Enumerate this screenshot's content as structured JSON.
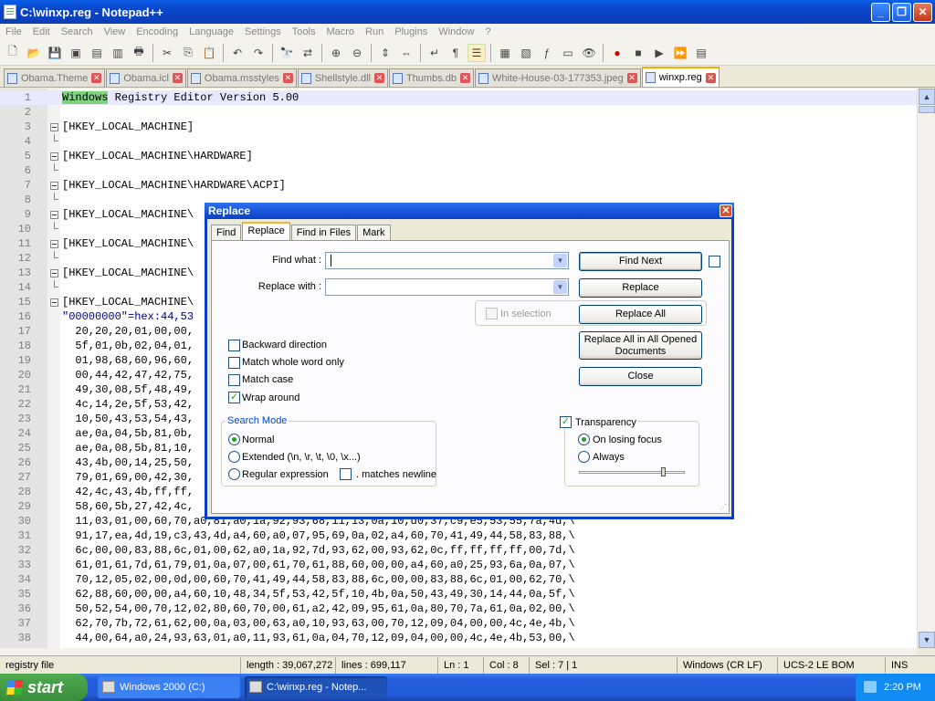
{
  "window": {
    "title": "C:\\winxp.reg - Notepad++"
  },
  "menu": [
    "File",
    "Edit",
    "Search",
    "View",
    "Encoding",
    "Language",
    "Settings",
    "Tools",
    "Macro",
    "Run",
    "Plugins",
    "Window",
    "?"
  ],
  "tabs": [
    {
      "label": "Obama.Theme",
      "active": false
    },
    {
      "label": "Obama.icl",
      "active": false
    },
    {
      "label": "Obama.msstyles",
      "active": false
    },
    {
      "label": "Shellstyle.dll",
      "active": false
    },
    {
      "label": "Thumbs.db",
      "active": false
    },
    {
      "label": "White-House-03-177353.jpeg",
      "active": false
    },
    {
      "label": "winxp.reg",
      "active": true
    }
  ],
  "editor": {
    "lines": [
      {
        "n": "1",
        "text": "Windows Registry Editor Version 5.00"
      },
      {
        "n": "2",
        "text": ""
      },
      {
        "n": "3",
        "text": "[HKEY_LOCAL_MACHINE]"
      },
      {
        "n": "4",
        "text": ""
      },
      {
        "n": "5",
        "text": "[HKEY_LOCAL_MACHINE\\HARDWARE]"
      },
      {
        "n": "6",
        "text": ""
      },
      {
        "n": "7",
        "text": "[HKEY_LOCAL_MACHINE\\HARDWARE\\ACPI]"
      },
      {
        "n": "8",
        "text": ""
      },
      {
        "n": "9",
        "text": "[HKEY_LOCAL_MACHINE\\"
      },
      {
        "n": "10",
        "text": ""
      },
      {
        "n": "11",
        "text": "[HKEY_LOCAL_MACHINE\\"
      },
      {
        "n": "12",
        "text": ""
      },
      {
        "n": "13",
        "text": "[HKEY_LOCAL_MACHINE\\"
      },
      {
        "n": "14",
        "text": ""
      },
      {
        "n": "15",
        "text": "[HKEY_LOCAL_MACHINE\\"
      },
      {
        "n": "16",
        "text": "\"00000000\"=hex:44,53"
      },
      {
        "n": "17",
        "text": "  20,20,20,01,00,00,"
      },
      {
        "n": "18",
        "text": "  5f,01,0b,02,04,01,"
      },
      {
        "n": "19",
        "text": "  01,98,68,60,96,60,"
      },
      {
        "n": "20",
        "text": "  00,44,42,47,42,75,"
      },
      {
        "n": "21",
        "text": "  49,30,08,5f,48,49,"
      },
      {
        "n": "22",
        "text": "  4c,14,2e,5f,53,42,"
      },
      {
        "n": "23",
        "text": "  10,50,43,53,54,43,"
      },
      {
        "n": "24",
        "text": "  ae,0a,04,5b,81,0b,"
      },
      {
        "n": "25",
        "text": "  ae,0a,08,5b,81,10,"
      },
      {
        "n": "26",
        "text": "  43,4b,00,14,25,50,"
      },
      {
        "n": "27",
        "text": "  79,01,69,00,42,30,"
      },
      {
        "n": "28",
        "text": "  42,4c,43,4b,ff,ff,"
      },
      {
        "n": "29",
        "text": "  58,60,5b,27,42,4c,"
      },
      {
        "n": "30",
        "text": "  11,03,01,00,60,70,a0,81,a0,1a,92,93,68,11,13,0a,10,d0,37,c9,e5,53,55,7a,4d,\\"
      },
      {
        "n": "31",
        "text": "  91,17,ea,4d,19,c3,43,4d,a4,60,a0,07,95,69,0a,02,a4,60,70,41,49,44,58,83,88,\\"
      },
      {
        "n": "32",
        "text": "  6c,00,00,83,88,6c,01,00,62,a0,1a,92,7d,93,62,00,93,62,0c,ff,ff,ff,ff,00,7d,\\"
      },
      {
        "n": "33",
        "text": "  61,01,61,7d,61,79,01,0a,07,00,61,70,61,88,60,00,00,a4,60,a0,25,93,6a,0a,07,\\"
      },
      {
        "n": "34",
        "text": "  70,12,05,02,00,0d,00,60,70,41,49,44,58,83,88,6c,00,00,83,88,6c,01,00,62,70,\\"
      },
      {
        "n": "35",
        "text": "  62,88,60,00,00,a4,60,10,48,34,5f,53,42,5f,10,4b,0a,50,43,49,30,14,44,0a,5f,\\"
      },
      {
        "n": "36",
        "text": "  50,52,54,00,70,12,02,80,60,70,00,61,a2,42,09,95,61,0a,80,70,7a,61,0a,02,00,\\"
      },
      {
        "n": "37",
        "text": "  62,70,7b,72,61,62,00,0a,03,00,63,a0,10,93,63,00,70,12,09,04,00,00,4c,4e,4b,\\"
      },
      {
        "n": "38",
        "text": "  44,00,64,a0,24,93,63,01,a0,11,93,61,0a,04,70,12,09,04,00,00,4c,4e,4b,53,00,\\"
      }
    ]
  },
  "status": {
    "file_type": "registry file",
    "length": "length : 39,067,272",
    "lines": "lines : 699,117",
    "ln": "Ln : 1",
    "col": "Col : 8",
    "sel": "Sel : 7 | 1",
    "eol": "Windows (CR LF)",
    "encoding": "UCS-2 LE BOM",
    "mode": "INS"
  },
  "dialog": {
    "title": "Replace",
    "tabs": [
      "Find",
      "Replace",
      "Find in Files",
      "Mark"
    ],
    "active_tab": "Replace",
    "find_label": "Find what :",
    "find_value": "",
    "replace_label": "Replace with :",
    "replace_value": "",
    "in_selection": "In selection",
    "buttons": {
      "find_next": "Find Next",
      "replace": "Replace",
      "replace_all": "Replace All",
      "replace_all_docs": "Replace All in All Opened Documents",
      "close": "Close"
    },
    "options": {
      "backward": {
        "label": "Backward direction",
        "checked": false
      },
      "whole_word": {
        "label": "Match whole word only",
        "checked": false
      },
      "match_case": {
        "label": "Match case",
        "checked": false
      },
      "wrap": {
        "label": "Wrap around",
        "checked": true
      }
    },
    "search_mode": {
      "title": "Search Mode",
      "normal": "Normal",
      "extended": "Extended (\\n, \\r, \\t, \\0, \\x...)",
      "regex": "Regular expression",
      "matches_newline": ". matches newline",
      "selected": "normal"
    },
    "transparency": {
      "label": "Transparency",
      "checked": true,
      "on_losing_focus": "On losing focus",
      "always": "Always",
      "selected": "on_losing_focus",
      "level": 0.8
    }
  },
  "taskbar": {
    "start": "start",
    "tasks": [
      {
        "label": "Windows 2000 (C:)",
        "active": false
      },
      {
        "label": "C:\\winxp.reg - Notep...",
        "active": true
      }
    ],
    "clock": "2:20 PM"
  }
}
